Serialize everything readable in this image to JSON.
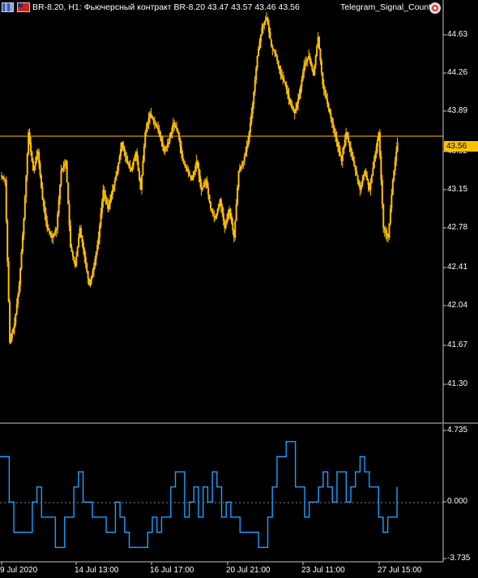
{
  "header": {
    "symbol_line": "BR-8.20, H1:  Фьючерсный контракт BR-8.20  43.47 43.57 43.46 43.56",
    "indicator_name": "Telegram_Signal_Count"
  },
  "price_axis": [
    "44.63",
    "44.26",
    "43.89",
    "43.52",
    "43.15",
    "42.78",
    "42.41",
    "42.04",
    "41.67",
    "41.30"
  ],
  "current_price": "43.56",
  "indicator_axis": [
    "4.735",
    "0.000",
    "-3.735"
  ],
  "time_axis": [
    "9 Jul 2020",
    "14 Jul 13:00",
    "16 Jul 17:00",
    "20 Jul 21:00",
    "23 Jul 11:00",
    "27 Jul 15:00"
  ],
  "colors": {
    "background": "#000000",
    "candle": "#ffc000",
    "indicator_line": "#1e9fff",
    "current_price_line": "#ffc000",
    "axis_text": "#ffffff",
    "separator": "#c8c8c8"
  },
  "chart_data": [
    {
      "type": "line",
      "title": "BR-8.20, H1",
      "ylim": [
        41.0,
        44.9
      ],
      "close_series": [
        43.1,
        41.4,
        41.6,
        42.0,
        42.7,
        43.6,
        43.2,
        43.4,
        42.9,
        42.6,
        42.5,
        42.6,
        43.2,
        43.3,
        42.4,
        42.2,
        42.6,
        42.3,
        42.0,
        42.2,
        42.5,
        43.0,
        42.8,
        43.0,
        43.2,
        43.5,
        43.3,
        43.2,
        43.4,
        43.0,
        43.6,
        43.8,
        43.7,
        43.6,
        43.4,
        43.5,
        43.7,
        43.6,
        43.3,
        43.2,
        43.1,
        43.3,
        43.0,
        43.1,
        42.8,
        42.7,
        42.9,
        42.6,
        42.8,
        42.5,
        43.2,
        43.3,
        43.5,
        43.9,
        44.4,
        44.7,
        44.8,
        44.5,
        44.4,
        44.2,
        44.1,
        43.9,
        43.8,
        44.0,
        44.3,
        44.4,
        44.2,
        44.6,
        44.1,
        43.9,
        43.7,
        43.5,
        43.3,
        43.6,
        43.4,
        43.2,
        43.0,
        43.2,
        43.0,
        43.3,
        43.6,
        42.6,
        42.5,
        43.1,
        43.5
      ]
    },
    {
      "type": "line",
      "title": "Telegram_Signal_Count",
      "ylim": [
        -3.735,
        4.735
      ],
      "values": [
        3,
        3,
        0,
        -2,
        -2,
        -2,
        -2,
        0,
        1,
        -1,
        -1,
        -1,
        -3,
        -3,
        -1,
        -1,
        1,
        2,
        0,
        0,
        -1,
        -1,
        -1,
        -2,
        -2,
        0,
        -1,
        -2,
        -3,
        -3,
        -3,
        -3,
        -2,
        -1,
        -2,
        -1,
        -1,
        1,
        2,
        2,
        -1,
        0,
        1,
        -1,
        1,
        0,
        2,
        1,
        -1,
        0,
        -1,
        -1,
        -2,
        -2,
        -2,
        -2,
        -3,
        -3,
        -1,
        1,
        3,
        3,
        4,
        4,
        1,
        1,
        -1,
        0,
        0,
        1,
        2,
        1,
        0,
        2,
        2,
        0,
        1,
        2,
        3,
        2,
        1,
        1,
        -1,
        -2,
        -1,
        -1,
        1
      ]
    }
  ]
}
